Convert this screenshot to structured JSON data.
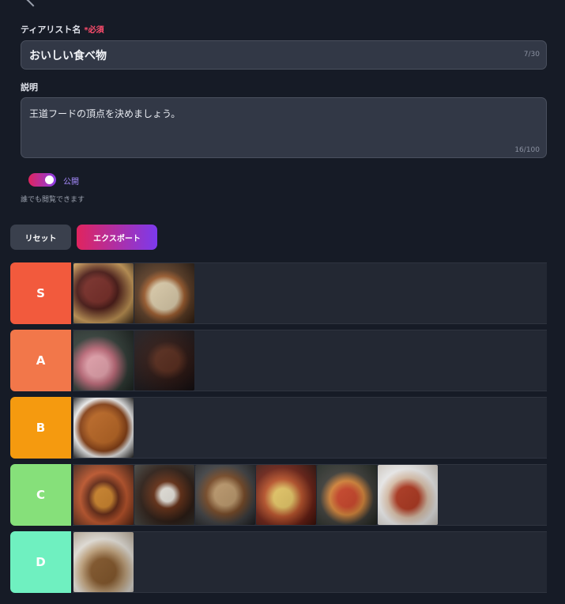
{
  "form": {
    "name_label": "ティアリスト名",
    "required_label": "*必須",
    "name_value": "おいしい食べ物",
    "name_counter": "7/30",
    "desc_label": "説明",
    "desc_value": "王道フードの頂点を決めましょう。",
    "desc_counter": "16/100",
    "public_label": "公開",
    "public_on": true,
    "public_hint": "誰でも閲覧できます"
  },
  "actions": {
    "reset_label": "リセット",
    "export_label": "エクスポート"
  },
  "tiers": [
    {
      "label": "S",
      "color": "#f25a3d",
      "items": [
        "steak-photo",
        "ramen-photo"
      ]
    },
    {
      "label": "A",
      "color": "#f2774a",
      "items": [
        "tuna-sushi-photo",
        "yakiniku-photo"
      ]
    },
    {
      "label": "B",
      "color": "#f59a0f",
      "items": [
        "karaage-photo"
      ]
    },
    {
      "label": "C",
      "color": "#86e07a",
      "items": [
        "hamburger-photo",
        "curry-rice-photo",
        "okonomiyaki-photo",
        "cheese-dish-photo",
        "pasta-photo",
        "mapo-tofu-photo"
      ]
    },
    {
      "label": "D",
      "color": "#6ff0c0",
      "items": [
        "natto-photo"
      ]
    }
  ]
}
